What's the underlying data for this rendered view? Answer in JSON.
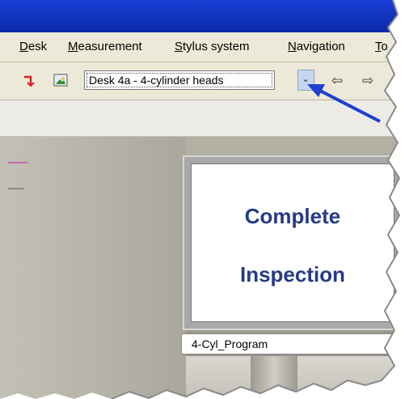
{
  "menu": {
    "items": [
      {
        "underline": "D",
        "rest": "esk"
      },
      {
        "underline": "M",
        "rest": "easurement"
      },
      {
        "underline": "S",
        "rest": "tylus system"
      },
      {
        "underline": "N",
        "rest": "avigation"
      },
      {
        "underline": "T",
        "rest": "o"
      }
    ]
  },
  "toolbar": {
    "desk_select_value": "Desk 4a - 4-cylinder heads",
    "dropdown_glyph": "⌄",
    "back_glyph": "⇦",
    "forward_glyph": "⇨"
  },
  "panel": {
    "line1": "Complete",
    "line2": "Inspection",
    "program_label": "4-Cyl_Program"
  },
  "colors": {
    "titlebar": "#0a2aa6",
    "panel_text": "#283a86",
    "callout_arrow": "#1f3fd0"
  }
}
